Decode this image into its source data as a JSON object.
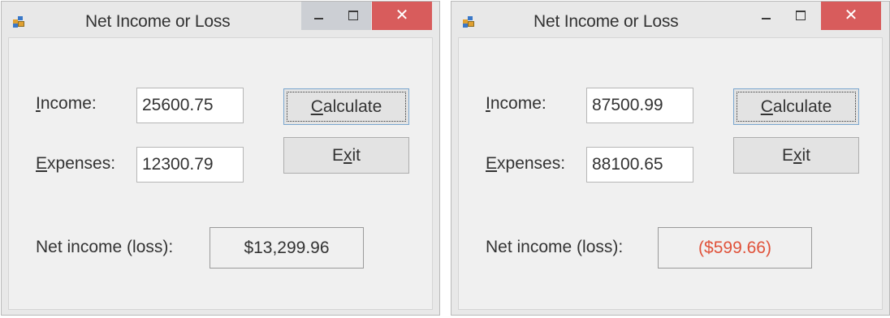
{
  "windows": [
    {
      "title": "Net Income or Loss",
      "income_label": {
        "accel": "I",
        "rest": "ncome:"
      },
      "expenses_label": {
        "accel": "E",
        "rest": "xpenses:"
      },
      "income_value": "25600.75",
      "expenses_value": "12300.79",
      "calculate_button": {
        "accel": "C",
        "rest": "alculate"
      },
      "exit_button": {
        "pre": "E",
        "accel": "x",
        "rest": "it"
      },
      "net_label": "Net income (loss):",
      "net_value": "$13,299.96",
      "net_color": "#333333",
      "close_glyph": "✕"
    },
    {
      "title": "Net Income or Loss",
      "income_label": {
        "accel": "I",
        "rest": "ncome:"
      },
      "expenses_label": {
        "accel": "E",
        "rest": "xpenses:"
      },
      "income_value": "87500.99",
      "expenses_value": "88100.65",
      "calculate_button": {
        "accel": "C",
        "rest": "alculate"
      },
      "exit_button": {
        "pre": "E",
        "accel": "x",
        "rest": "it"
      },
      "net_label": "Net income (loss):",
      "net_value": "($599.66)",
      "net_color": "#e0523a",
      "close_glyph": "✕"
    }
  ]
}
